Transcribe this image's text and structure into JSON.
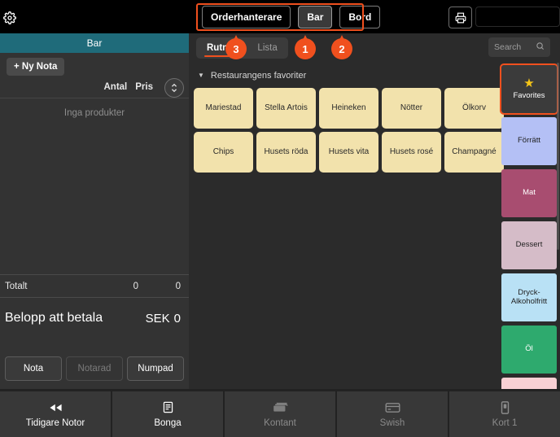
{
  "topbar": {
    "gear_icon": "gear-icon",
    "segments": [
      {
        "label": "Orderhanterare",
        "active": false
      },
      {
        "label": "Bar",
        "active": true
      },
      {
        "label": "Bord",
        "active": false
      }
    ],
    "print_icon": "printer-icon",
    "header_field_value": ""
  },
  "annotations": [
    {
      "number": "1",
      "target": "bar-button"
    },
    {
      "number": "2",
      "target": "bord-button"
    },
    {
      "number": "3",
      "target": "rutnat-tab"
    }
  ],
  "order_panel": {
    "venue": "Bar",
    "new_note_label": "+ Ny Nota",
    "col_qty": "Antal",
    "col_price": "Pris",
    "sort_icon": "sort-updown-icon",
    "empty_message": "Inga produkter",
    "totals": {
      "label": "Totalt",
      "qty": "0",
      "price": "0"
    },
    "amount": {
      "label": "Belopp att betala",
      "currency": "SEK",
      "value": "0"
    },
    "pay_tabs": [
      {
        "label": "Nota",
        "disabled": false
      },
      {
        "label": "Notarad",
        "disabled": true
      },
      {
        "label": "Numpad",
        "disabled": false
      }
    ]
  },
  "main": {
    "view_tabs": [
      {
        "label": "Rutnät",
        "active": true
      },
      {
        "label": "Lista",
        "active": false
      }
    ],
    "search": {
      "placeholder": "Search",
      "value": "",
      "icon": "search-icon"
    },
    "group_title": "Restaurangens favoriter",
    "caret_icon": "caret-down-icon",
    "tiles": [
      "Mariestad",
      "Stella Artois",
      "Heineken",
      "Nötter",
      "Ölkorv",
      "Chips",
      "Husets röda",
      "Husets vita",
      "Husets rosé",
      "Champagné"
    ],
    "tile_color": "#f2e2ac"
  },
  "categories": [
    {
      "label": "Favorites",
      "color": "#3b3b3b",
      "text": "#ffffff",
      "selected": true,
      "icon": "star-icon"
    },
    {
      "label": "Förrätt",
      "color": "#b4c0f5",
      "text": "#1f1f1f",
      "selected": false,
      "icon": ""
    },
    {
      "label": "Mat",
      "color": "#a84d70",
      "text": "#ffffff",
      "selected": false,
      "icon": ""
    },
    {
      "label": "Dessert",
      "color": "#d5bcc8",
      "text": "#1f1f1f",
      "selected": false,
      "icon": ""
    },
    {
      "label": "Dryck-Alkoholfritt",
      "color": "#b9e1f5",
      "text": "#1f1f1f",
      "selected": false,
      "icon": ""
    },
    {
      "label": "Öl",
      "color": "#2eaa6e",
      "text": "#ffffff",
      "selected": false,
      "icon": ""
    },
    {
      "label": "",
      "color": "#f8d0d4",
      "text": "#1f1f1f",
      "selected": false,
      "icon": ""
    }
  ],
  "bottom_nav": [
    {
      "label": "Tidigare Notor",
      "icon": "rewind-icon",
      "dim": false
    },
    {
      "label": "Bonga",
      "icon": "receipt-icon",
      "dim": false
    },
    {
      "label": "Kontant",
      "icon": "cash-icon",
      "dim": true
    },
    {
      "label": "Swish",
      "icon": "card-icon",
      "dim": true
    },
    {
      "label": "Kort 1",
      "icon": "terminal-icon",
      "dim": true
    }
  ],
  "colors": {
    "accent_orange": "#f0501e",
    "teal": "#1f6b7a",
    "star_yellow": "#f5c518"
  }
}
